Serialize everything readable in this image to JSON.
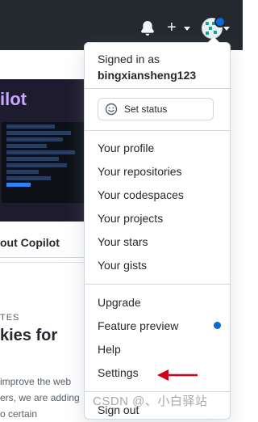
{
  "menu": {
    "signed_in_as": "Signed in as",
    "username": "bingxiansheng123",
    "status_button": "Set status",
    "items": [
      "Your profile",
      "Your repositories",
      "Your codespaces",
      "Your projects",
      "Your stars",
      "Your gists",
      "Upgrade",
      "Feature preview",
      "Help",
      "Settings",
      "Sign out"
    ]
  },
  "background": {
    "hero_title": "ilot",
    "hero_caption": "out Copilot",
    "kicker": "TES",
    "headline": "kies for",
    "body_lines": [
      "improve the web",
      "ers, we are adding",
      "o certain"
    ]
  },
  "watermark": "CSDN @、小白驿站",
  "colors": {
    "header": "#24292f",
    "accent_blue": "#0969da",
    "arrow_red": "#d0021b"
  }
}
